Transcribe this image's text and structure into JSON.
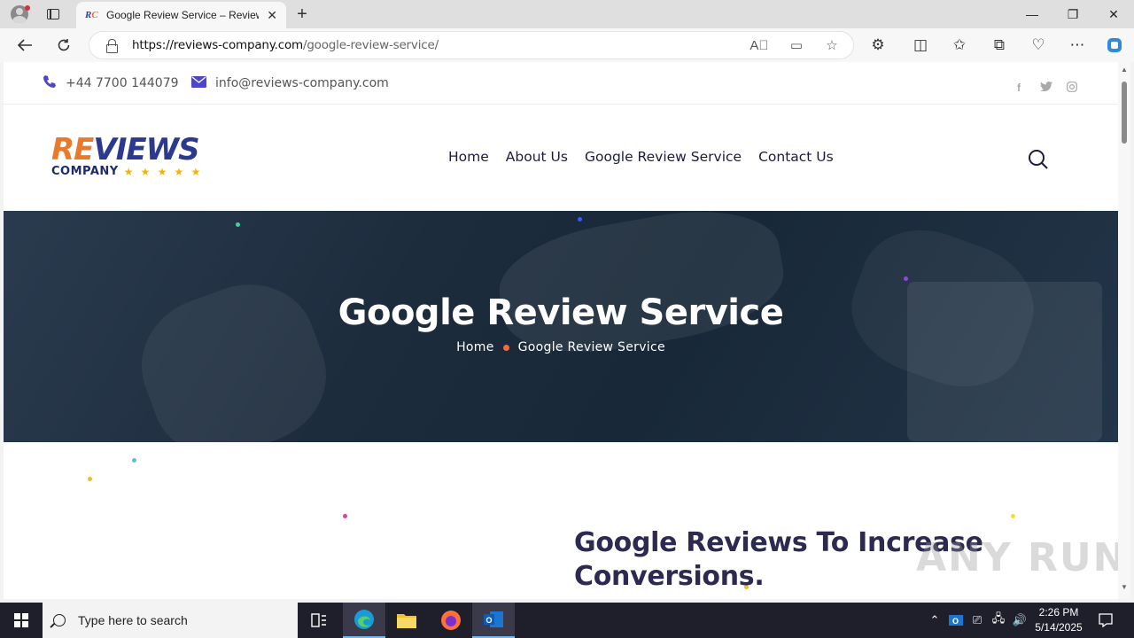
{
  "browser": {
    "tab_title": "Google Review Service – Reviews",
    "tab_favicon": "RC",
    "url_domain": "https://reviews-company.com",
    "url_path": "/google-review-service/",
    "new_tab_label": "+"
  },
  "site": {
    "phone": "+44 7700 144079",
    "email": "info@reviews-company.com",
    "social_icons": [
      "facebook-icon",
      "twitter-icon",
      "instagram-icon"
    ],
    "logo": {
      "word_a": "RE",
      "word_b": "VIEWS",
      "word_c": "",
      "sub": "COMPANY",
      "stars": "★ ★ ★ ★ ★"
    },
    "menu": [
      "Home",
      "About Us",
      "Google Review Service",
      "Contact Us"
    ],
    "hero_title": "Google Review Service",
    "breadcrumb": {
      "home": "Home",
      "current": "Google Review Service"
    },
    "section_heading_line1": "Google Reviews To Increase",
    "section_heading_line2": "Conversions."
  },
  "watermark": "ANY RUN",
  "taskbar": {
    "search_placeholder": "Type here to search",
    "time": "2:26 PM",
    "date": "5/14/2025"
  },
  "colors": {
    "accent_blue": "#4f46c7",
    "brand_orange": "#ea7a2b",
    "brand_navy": "#2b3a8f",
    "hero_bg": "#1d2c3d",
    "heading": "#2d2a52"
  }
}
